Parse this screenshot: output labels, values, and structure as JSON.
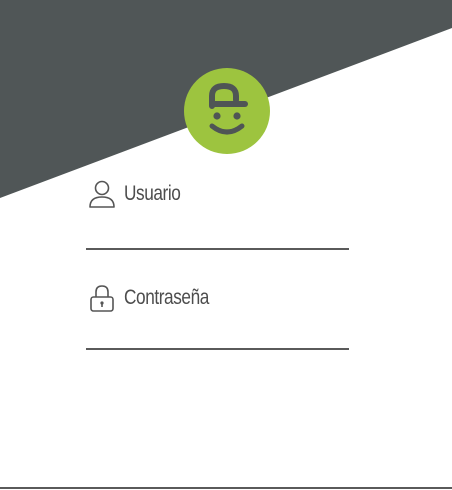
{
  "login": {
    "colors": {
      "header_bg": "#505657",
      "avatar_bg": "#9dc43f",
      "avatar_face": "#4f5555",
      "text": "#4d4d4d",
      "underline": "#5a5a5a"
    },
    "avatar_icon": "smiley-cap-logo-icon",
    "username": {
      "label": "Usuario",
      "icon": "user-icon",
      "value": ""
    },
    "password": {
      "label": "Contraseña",
      "icon": "lock-icon",
      "value": ""
    }
  }
}
